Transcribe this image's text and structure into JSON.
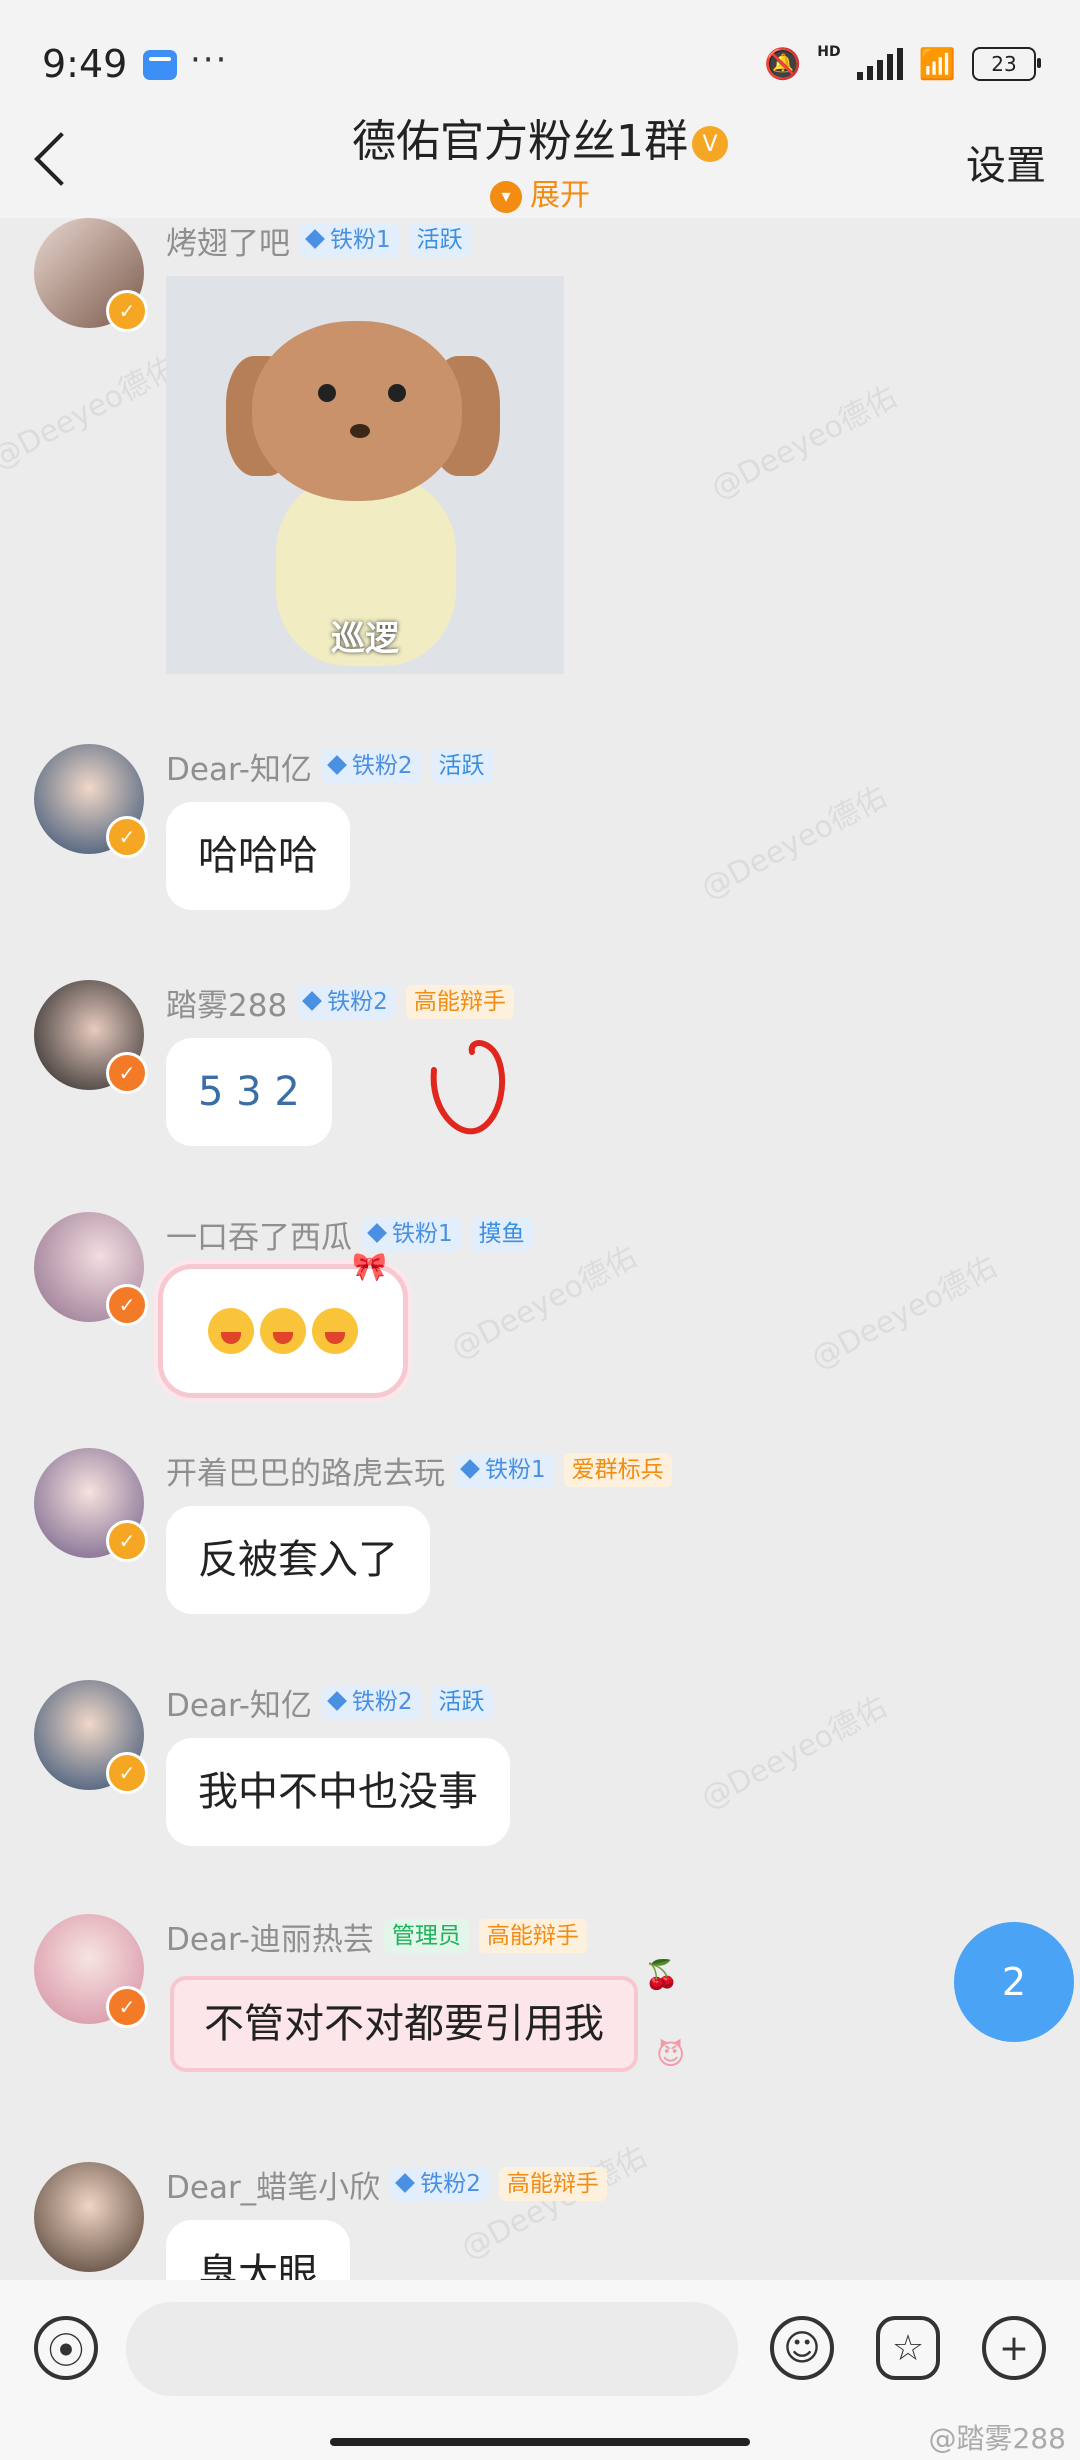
{
  "status_bar": {
    "time": "9:49",
    "battery": "23",
    "network_label": "HD"
  },
  "header": {
    "title": "德佑官方粉丝1群",
    "verified_badge": "V",
    "expand_label": "展开",
    "settings_label": "设置"
  },
  "watermark": "@Deeyeo德佑",
  "messages": [
    {
      "nick": "烤翅了吧",
      "fan_tag": "铁粉1",
      "role_tag": "活跃",
      "type": "image",
      "image_caption": "巡逻"
    },
    {
      "nick": "Dear-知亿",
      "fan_tag": "铁粉2",
      "role_tag": "活跃",
      "type": "text",
      "text": "哈哈哈"
    },
    {
      "nick": "踏雾288",
      "fan_tag": "铁粉2",
      "role_tag": "高能辩手",
      "type": "text",
      "text": "5 3 2"
    },
    {
      "nick": "一口吞了西瓜",
      "fan_tag": "铁粉1",
      "role_tag": "摸鱼",
      "type": "sticker"
    },
    {
      "nick": "开着巴巴的路虎去玩",
      "fan_tag": "铁粉1",
      "role_tag": "爱群标兵",
      "type": "text",
      "text": "反被套入了"
    },
    {
      "nick": "Dear-知亿",
      "fan_tag": "铁粉2",
      "role_tag": "活跃",
      "type": "text",
      "text": "我中不中也没事"
    },
    {
      "nick": "Dear-迪丽热芸",
      "admin_tag": "管理员",
      "role_tag": "高能辩手",
      "type": "text",
      "text": "不管对不对都要引用我"
    },
    {
      "nick": "Dear_蜡笔小欣",
      "fan_tag": "铁粉2",
      "role_tag": "高能辩手",
      "type": "text",
      "text": "臭大眼"
    }
  ],
  "unread_count": "2",
  "credit": "@踏雾288",
  "colors": {
    "accent_orange": "#f28c12",
    "fab_blue": "#4aa3f4",
    "chat_bg": "#ececec"
  }
}
